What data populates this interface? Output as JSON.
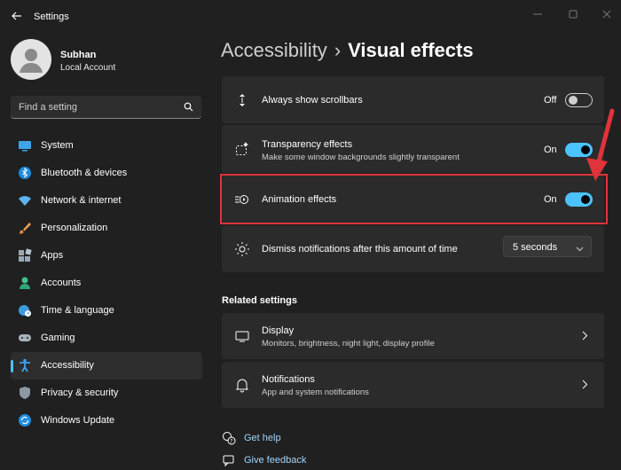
{
  "window": {
    "title": "Settings"
  },
  "profile": {
    "name": "Subhan",
    "account_type": "Local Account"
  },
  "search": {
    "placeholder": "Find a setting"
  },
  "sidebar": {
    "items": [
      {
        "label": "System",
        "icon": "monitor-icon"
      },
      {
        "label": "Bluetooth & devices",
        "icon": "bluetooth-icon"
      },
      {
        "label": "Network & internet",
        "icon": "wifi-icon"
      },
      {
        "label": "Personalization",
        "icon": "brush-icon"
      },
      {
        "label": "Apps",
        "icon": "apps-icon"
      },
      {
        "label": "Accounts",
        "icon": "person-icon"
      },
      {
        "label": "Time & language",
        "icon": "globe-clock-icon"
      },
      {
        "label": "Gaming",
        "icon": "gamepad-icon"
      },
      {
        "label": "Accessibility",
        "icon": "accessibility-icon",
        "active": true
      },
      {
        "label": "Privacy & security",
        "icon": "shield-icon"
      },
      {
        "label": "Windows Update",
        "icon": "update-icon"
      }
    ]
  },
  "breadcrumb": {
    "parent": "Accessibility",
    "separator": "›",
    "current": "Visual effects"
  },
  "settings": {
    "scrollbars": {
      "title": "Always show scrollbars",
      "state": "Off",
      "on": false
    },
    "transparency": {
      "title": "Transparency effects",
      "desc": "Make some window backgrounds slightly transparent",
      "state": "On",
      "on": true
    },
    "animation": {
      "title": "Animation effects",
      "state": "On",
      "on": true
    },
    "notifications_time": {
      "title": "Dismiss notifications after this amount of time",
      "value": "5 seconds"
    }
  },
  "related": {
    "title": "Related settings",
    "display": {
      "title": "Display",
      "desc": "Monitors, brightness, night light, display profile"
    },
    "notifications": {
      "title": "Notifications",
      "desc": "App and system notifications"
    }
  },
  "links": {
    "help": "Get help",
    "feedback": "Give feedback"
  },
  "colors": {
    "accent": "#4cc2ff",
    "highlight": "#e0333b",
    "background": "#202020",
    "card": "#2b2b2b"
  }
}
